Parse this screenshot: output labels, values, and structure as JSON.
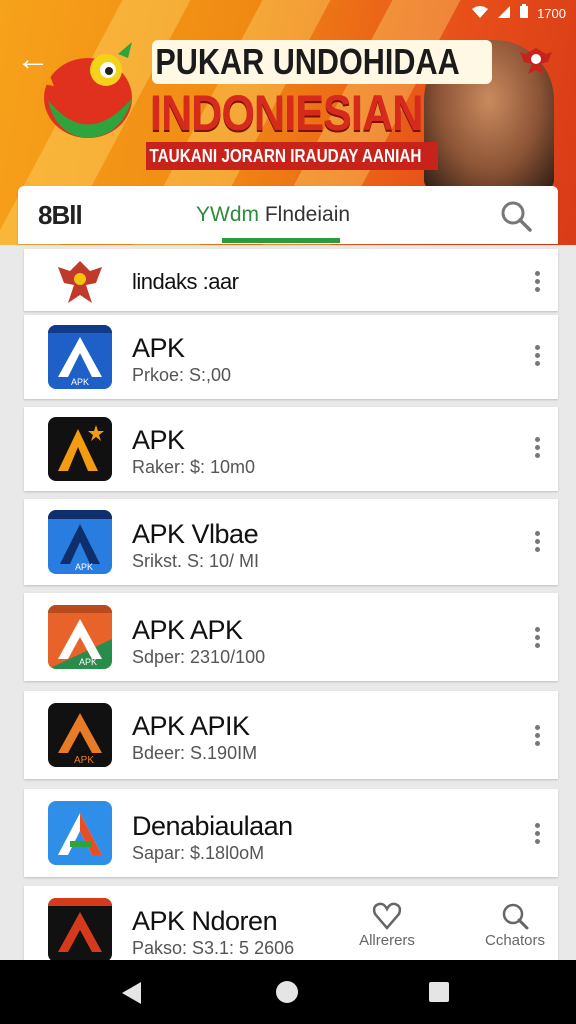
{
  "status_bar": {
    "time": "1700"
  },
  "banner": {
    "title_line1": "PUKAR UNDOHIDAA",
    "title_line2": "INDONIESIAN",
    "tagline": "TAUKANI JORARN IRAUDAY AANIAH"
  },
  "tabs": {
    "left_label": "8Bll",
    "active_label_prefix": "YWdm",
    "active_label_rest": " Flndeiain"
  },
  "apps": [
    {
      "name": "lindaks :aar",
      "subtitle": "",
      "icon": "garuda-icon",
      "colors": [
        "#ffffff",
        "#c0392b"
      ]
    },
    {
      "name": "APK",
      "subtitle": "Prkoe: S:,00",
      "icon": "apk-blue-icon",
      "colors": [
        "#1f5fc8",
        "#123a8a"
      ]
    },
    {
      "name": "APK",
      "subtitle": "Raker: $: 10m0",
      "icon": "apk-orange-icon",
      "colors": [
        "#111111",
        "#f39c12"
      ]
    },
    {
      "name": "APK Vlbae",
      "subtitle": "Srikst. S: 10/ MI",
      "icon": "apk-navy-icon",
      "colors": [
        "#2a7de0",
        "#0e2f6b"
      ]
    },
    {
      "name": "APK APK",
      "subtitle": "Sdper: 2310/100",
      "icon": "apk-tricolor-icon",
      "colors": [
        "#2a8c4a",
        "#e8632a"
      ]
    },
    {
      "name": "APK APIK",
      "subtitle": "Bdeer: S.190IM",
      "icon": "apk-black-orange-icon",
      "colors": [
        "#111111",
        "#e87b26"
      ]
    },
    {
      "name": "Denabiaulaan",
      "subtitle": "Sapar: $.18l0oM",
      "icon": "apk-bright-icon",
      "colors": [
        "#2f8fe8",
        "#e84e26"
      ]
    },
    {
      "name": "APK Ndoren",
      "subtitle": "Pakso: S3.1: 5 2606",
      "icon": "apk-red-icon",
      "colors": [
        "#111111",
        "#d63a1c"
      ]
    }
  ],
  "bottom_actions": {
    "left_label": "Allrerers",
    "right_label": "Cchators"
  },
  "theme": {
    "accent_green": "#2e9a3e",
    "banner_orange": "#f08a13",
    "banner_red": "#d62a1c"
  }
}
